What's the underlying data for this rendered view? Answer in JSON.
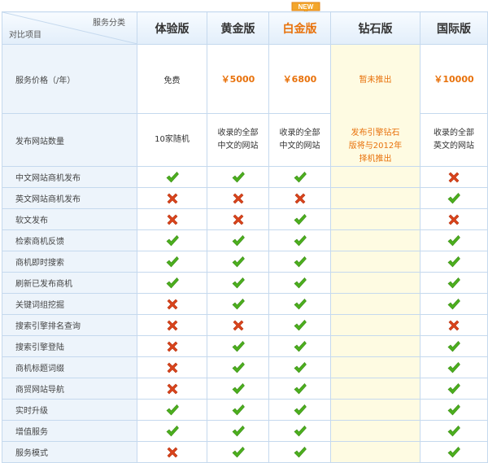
{
  "header": {
    "corner_top": "服务分类",
    "corner_bottom": "对比项目",
    "columns": [
      "体验版",
      "黄金版",
      "白金版",
      "钻石版",
      "国际版"
    ],
    "new_badge": "NEW"
  },
  "rows": {
    "price_label": "服务价格（/年）",
    "prices": [
      "免费",
      "￥5000",
      "￥6800",
      "",
      "￥10000"
    ],
    "diamond_status": "暂未推出",
    "sites_label": "发布网站数量",
    "sites": [
      "10家随机",
      "收录的全部\n中文的网站",
      "收录的全部\n中文的网站",
      "",
      "收录的全部\n英文的网站"
    ],
    "diamond_note": "发布引擎钻石\n版将与2012年\n择机推出"
  },
  "features": [
    {
      "label": "中文网站商机发布",
      "values": [
        "check",
        "check",
        "check",
        "cross"
      ]
    },
    {
      "label": "英文网站商机发布",
      "values": [
        "cross",
        "cross",
        "cross",
        "check"
      ]
    },
    {
      "label": "软文发布",
      "values": [
        "cross",
        "cross",
        "check",
        "cross"
      ]
    },
    {
      "label": "检索商机反馈",
      "values": [
        "check",
        "check",
        "check",
        "check"
      ]
    },
    {
      "label": "商机即时搜索",
      "values": [
        "check",
        "check",
        "check",
        "check"
      ]
    },
    {
      "label": "刷新已发布商机",
      "values": [
        "check",
        "check",
        "check",
        "check"
      ]
    },
    {
      "label": "关键词组挖掘",
      "values": [
        "cross",
        "check",
        "check",
        "check"
      ]
    },
    {
      "label": "搜索引擎排名查询",
      "values": [
        "cross",
        "cross",
        "check",
        "cross"
      ]
    },
    {
      "label": "搜索引擎登陆",
      "values": [
        "cross",
        "check",
        "check",
        "check"
      ]
    },
    {
      "label": "商机标题词缀",
      "values": [
        "cross",
        "check",
        "check",
        "check"
      ]
    },
    {
      "label": "商贸网站导航",
      "values": [
        "cross",
        "check",
        "check",
        "check"
      ]
    },
    {
      "label": "实时升级",
      "values": [
        "check",
        "check",
        "check",
        "check"
      ]
    },
    {
      "label": "增值服务",
      "values": [
        "check",
        "check",
        "check",
        "check"
      ]
    },
    {
      "label": "服务模式",
      "values": [
        "cross",
        "check",
        "check",
        "check"
      ]
    }
  ],
  "colors": {
    "accent_orange": "#e8720c",
    "check_green": "#4caf1e",
    "cross_red": "#d9431c",
    "border_blue": "#c5d9ee",
    "label_bg": "#edf4fb",
    "diamond_bg": "#fefbe2"
  },
  "icons": {
    "check": "green-check-icon",
    "cross": "orange-cross-icon"
  }
}
